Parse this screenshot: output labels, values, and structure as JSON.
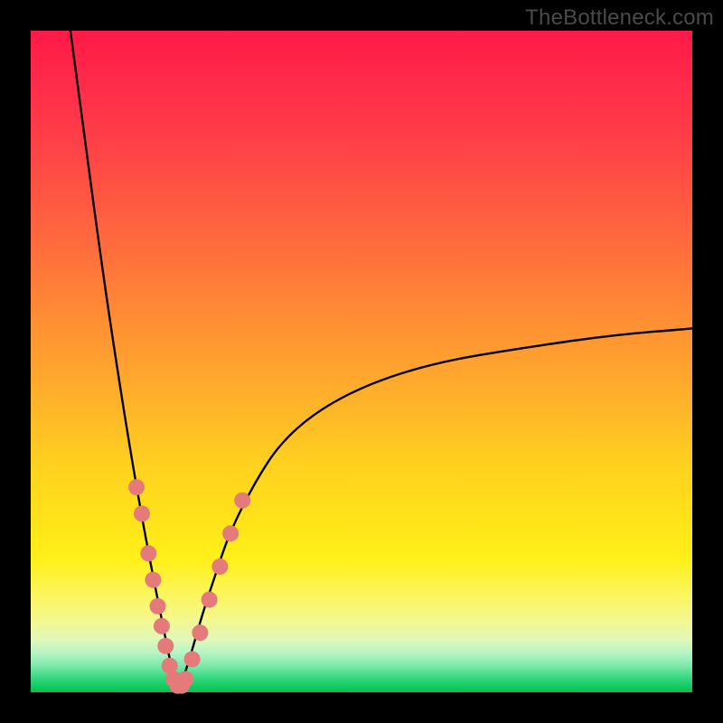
{
  "watermark": "TheBottleneck.com",
  "colors": {
    "frame": "#000000",
    "curve": "#000000",
    "bead": "#e47a7a"
  },
  "chart_data": {
    "type": "line",
    "title": "",
    "xlabel": "",
    "ylabel": "",
    "xlim": [
      0,
      100
    ],
    "ylim": [
      0,
      100
    ],
    "grid": false,
    "series": [
      {
        "name": "bottleneck-curve",
        "description": "V-shaped bottleneck curve; y≈0 at the optimum around x≈22, rising steeply on both sides (left branch nearly vertical toward 100, right branch asymptotic toward ~55).",
        "x": [
          6,
          8,
          10,
          12,
          14,
          16,
          18,
          20,
          21,
          22,
          23,
          24,
          26,
          28,
          30,
          34,
          38,
          44,
          52,
          62,
          74,
          88,
          100
        ],
        "y": [
          100,
          85,
          70,
          56,
          43,
          31,
          20,
          10,
          5,
          1,
          2,
          5,
          12,
          18,
          24,
          32,
          38,
          43,
          47,
          50,
          52,
          54,
          55
        ]
      }
    ],
    "markers": {
      "name": "highlighted-points",
      "description": "Pink bead markers clustered near the curve minimum, on both branches in the lower ~30% band.",
      "points": [
        {
          "x": 16.0,
          "y": 31
        },
        {
          "x": 16.8,
          "y": 27
        },
        {
          "x": 17.8,
          "y": 21
        },
        {
          "x": 18.5,
          "y": 17
        },
        {
          "x": 19.2,
          "y": 13
        },
        {
          "x": 19.8,
          "y": 10
        },
        {
          "x": 20.4,
          "y": 7
        },
        {
          "x": 21.0,
          "y": 4
        },
        {
          "x": 21.6,
          "y": 2
        },
        {
          "x": 22.2,
          "y": 1
        },
        {
          "x": 22.8,
          "y": 1
        },
        {
          "x": 23.4,
          "y": 2
        },
        {
          "x": 24.4,
          "y": 5
        },
        {
          "x": 25.6,
          "y": 9
        },
        {
          "x": 27.0,
          "y": 14
        },
        {
          "x": 28.6,
          "y": 19
        },
        {
          "x": 30.2,
          "y": 24
        },
        {
          "x": 32.0,
          "y": 29
        }
      ]
    }
  }
}
